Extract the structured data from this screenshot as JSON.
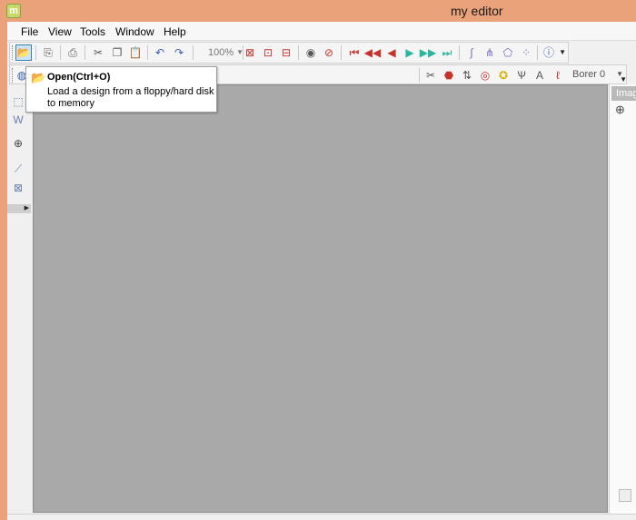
{
  "window": {
    "title": "my editor",
    "app_icon_letter": "m"
  },
  "menu": [
    "File",
    "View",
    "Tools",
    "Window",
    "Help"
  ],
  "toolbar": {
    "zoom_value": "100%",
    "combo_value": "Borer 0",
    "icons": [
      "open-icon",
      "import-icon",
      "print-icon",
      "cut-icon",
      "copy-icon",
      "paste-icon",
      "undo-icon",
      "redo-icon",
      "zoom-fit-icon",
      "zoom-page-icon",
      "zoom-width-icon",
      "view-icon",
      "hide-icon",
      "first-icon",
      "prev-fast-icon",
      "prev-icon",
      "next-icon",
      "next-fast-icon",
      "last-icon",
      "curve-icon",
      "stitch-icon",
      "shape-icon",
      "dots-icon",
      "info-icon"
    ]
  },
  "tooltip": {
    "title": "Open(Ctrl+O)",
    "description": "Load a design from a floppy/hard disk to memory"
  },
  "right_panel": {
    "header": "Image"
  },
  "colors": {
    "titlebar": "#e9a27a",
    "canvas": "#a9a9a9",
    "accent": "#3c7fb1"
  }
}
